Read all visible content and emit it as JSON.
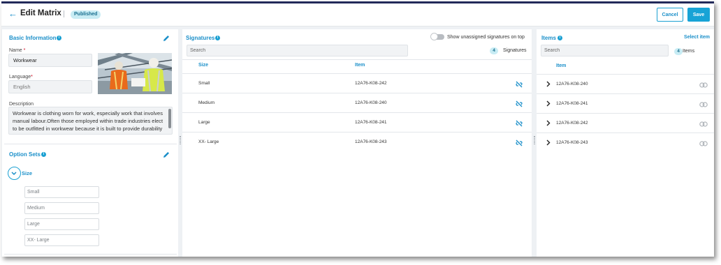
{
  "header": {
    "title": "Edit Matrix",
    "status": "Published",
    "cancel_label": "Cancel",
    "save_label": "Save"
  },
  "basic_info": {
    "title": "Basic Information",
    "name_label": "Name",
    "name_value": "Workwear",
    "language_label": "Language",
    "language_value": "English",
    "required_mark": "*",
    "description_label": "Description",
    "description_value": "Workwear is clothing worn for work, especially work that involves manual labour.Often those employed within trade industries elect to be outfitted in workwear because it is built to provide durability and safety.",
    "image_name": "workers-in-safety-vests-photo"
  },
  "option_sets": {
    "title": "Option Sets",
    "set_name": "Size",
    "options": [
      "Small",
      "Medium",
      "Large",
      "XX- Large"
    ]
  },
  "signatures": {
    "title": "Signatures",
    "toggle_label": "Show unassigned signatures on top",
    "search_placeholder": "Search",
    "count": "4",
    "count_label": "Signatures",
    "col_size": "Size",
    "col_item": "Item",
    "rows": [
      {
        "size": "Small",
        "item": "12A76-K08-242"
      },
      {
        "size": "Medium",
        "item": "12A76-K08-240"
      },
      {
        "size": "Large",
        "item": "12A76-K08-241"
      },
      {
        "size": "XX- Large",
        "item": "12A76-K08-243"
      }
    ]
  },
  "items": {
    "title": "Items",
    "select_label": "Select item",
    "search_placeholder": "Search",
    "count": "4",
    "count_label": "Items",
    "col_item": "Item",
    "rows": [
      "12A76-K08-240",
      "12A76-K08-241",
      "12A76-K08-242",
      "12A76-K08-243"
    ]
  },
  "colors": {
    "accent": "#1aa0d2",
    "header_border": "#222a5a",
    "badge_bg": "#c8ecf4"
  }
}
